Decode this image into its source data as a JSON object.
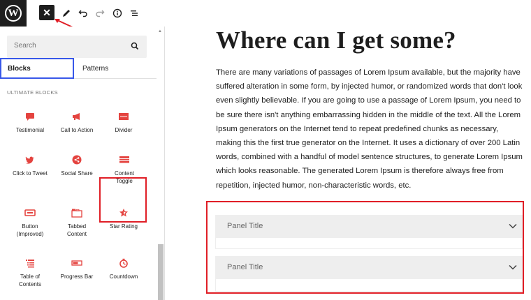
{
  "toolbar": {
    "logo_letter": "W",
    "close_label": "✕",
    "edit_icon": "pencil-icon",
    "undo_icon": "undo-icon",
    "redo_icon": "redo-icon",
    "info_icon": "info-icon",
    "outline_icon": "list-view-icon"
  },
  "sidebar": {
    "search_placeholder": "Search",
    "tabs": [
      {
        "label": "Blocks",
        "active": true
      },
      {
        "label": "Patterns",
        "active": false
      }
    ],
    "section_title": "ULTIMATE BLOCKS",
    "blocks": [
      {
        "label": "Testimonial",
        "icon": "testimonial-icon"
      },
      {
        "label": "Call to Action",
        "icon": "megaphone-icon"
      },
      {
        "label": "Divider",
        "icon": "divider-icon"
      },
      {
        "label": "Click to Tweet",
        "icon": "twitter-icon"
      },
      {
        "label": "Social Share",
        "icon": "share-icon"
      },
      {
        "label": "Content Toggle",
        "icon": "toggle-icon"
      },
      {
        "label": "Button (Improved)",
        "icon": "button-icon"
      },
      {
        "label": "Tabbed Content",
        "icon": "tabs-icon"
      },
      {
        "label": "Star Rating",
        "icon": "star-icon"
      },
      {
        "label": "Table of Contents",
        "icon": "toc-icon"
      },
      {
        "label": "Progress Bar",
        "icon": "progress-icon"
      },
      {
        "label": "Countdown",
        "icon": "timer-icon"
      }
    ]
  },
  "content": {
    "heading": "Where can I get some?",
    "paragraph": "There are many variations of passages of Lorem Ipsum available, but the majority have suffered alteration in some form, by injected humor, or randomized words that don't look even slightly believable. If you are going to use a passage of Lorem Ipsum, you need to be sure there isn't anything embarrassing hidden in the middle of the text. All the Lorem Ipsum generators on the Internet tend to repeat predefined chunks as necessary, making this the first true generator on the Internet. It uses a dictionary of over 200 Latin words, combined with a handful of model sentence structures, to generate Lorem Ipsum which looks reasonable. The generated Lorem Ipsum is therefore always free from repetition, injected humor, non-characteristic words, etc.",
    "panels": [
      {
        "title": "Panel Title"
      },
      {
        "title": "Panel Title"
      }
    ]
  },
  "colors": {
    "accent_red": "#e01e26",
    "block_icon_red": "#e4433f",
    "tab_blue": "#3858e9",
    "panel_bg": "#eeeeee"
  }
}
